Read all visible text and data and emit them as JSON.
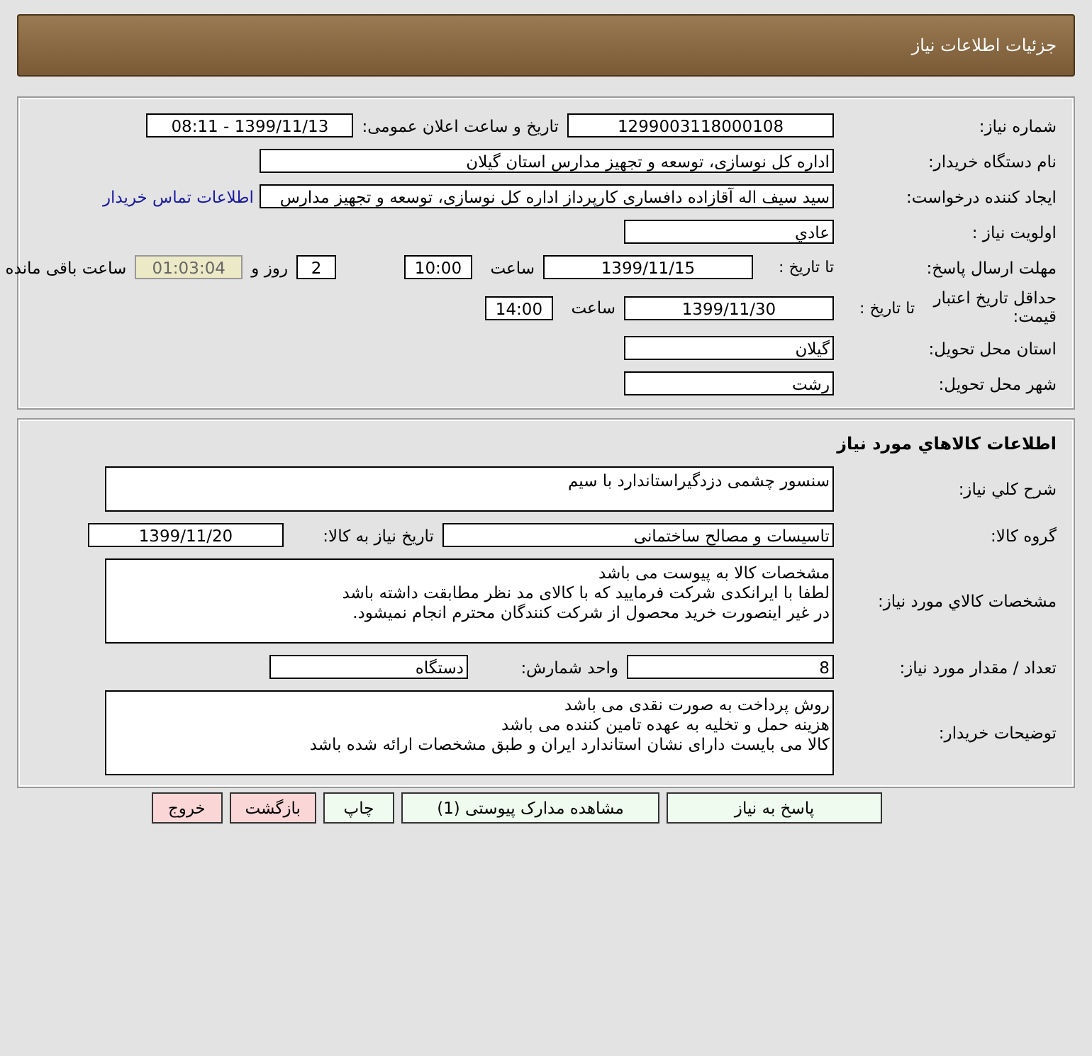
{
  "header": {
    "title": "جزئیات اطلاعات نیاز"
  },
  "need": {
    "number_label": "شماره نیاز:",
    "number": "1299003118000108",
    "announce_label": "تاریخ و ساعت اعلان عمومی:",
    "announce": "1399/11/13 - 08:11",
    "buyer_label": "نام دستگاه خریدار:",
    "buyer": "اداره کل نوسازی، توسعه و تجهیز مدارس استان گیلان",
    "creator_label": "ایجاد کننده درخواست:",
    "creator": "سید سیف اله آقازاده دافساری کارپرداز اداره کل نوسازی، توسعه و تجهیز مدارس",
    "contact_link": "اطلاعات تماس خریدار",
    "priority_label": "اولویت نیاز :",
    "priority": "عادي",
    "deadline_label": "مهلت ارسال پاسخ:",
    "deadline_to": "تا تاریخ :",
    "deadline_date": "1399/11/15",
    "deadline_hour_label": "ساعت",
    "deadline_hour": "10:00",
    "days": "2",
    "days_label": "روز و",
    "remaining": "01:03:04",
    "remaining_label": "ساعت باقی مانده",
    "validity_label": "حداقل تاریخ اعتبار قیمت:",
    "validity_to": "تا تاریخ :",
    "validity_date": "1399/11/30",
    "validity_hour_label": "ساعت",
    "validity_hour": "14:00",
    "province_label": "استان محل تحویل:",
    "province": "گیلان",
    "city_label": "شهر محل تحویل:",
    "city": "رشت"
  },
  "goods": {
    "title": "اطلاعات کالاهاي مورد نياز",
    "desc_label": "شرح کلي نياز:",
    "desc": "سنسور چشمی دزدگیراستاندارد با سیم",
    "group_label": "گروه کالا:",
    "group": "تاسیسات و مصالح ساختمانی",
    "need_date_label": "تاریخ نیاز به کالا:",
    "need_date": "1399/11/20",
    "spec_label": "مشخصات کالاي مورد نياز:",
    "spec_lines": [
      "مشخصات کالا به پیوست می باشد",
      "لطفا با ایرانکدی شرکت فرمایید که با کالای مد نظر مطابقت داشته باشد",
      "در غیر اینصورت خرید محصول از شرکت کنندگان محترم انجام نمیشود."
    ],
    "qty_label": "تعداد / مقدار مورد نیاز:",
    "qty": "8",
    "unit_label": "واحد شمارش:",
    "unit": "دستگاه",
    "notes_label": "توضیحات خریدار:",
    "notes_lines": [
      "روش پرداخت به صورت نقدی می باشد",
      "هزینه حمل و تخلیه به عهده تامین کننده می باشد",
      "کالا می بایست دارای نشان استاندارد ایران و طبق مشخصات ارائه شده باشد"
    ]
  },
  "buttons": [
    {
      "label": "پاسخ به نیاز",
      "kind": "action"
    },
    {
      "label": "مشاهده مدارک پیوستی (1)",
      "kind": "action"
    },
    {
      "label": "چاپ",
      "kind": "action"
    },
    {
      "label": "بازگشت",
      "kind": "exit"
    },
    {
      "label": "خروج",
      "kind": "exit"
    }
  ]
}
